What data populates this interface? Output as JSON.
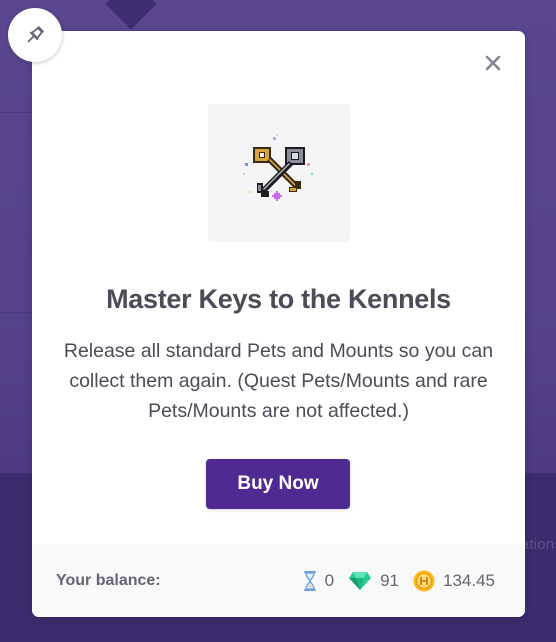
{
  "background": {
    "side_text": "ations"
  },
  "modal": {
    "title": "Master Keys to the Kennels",
    "description": "Release all standard Pets and Mounts so you can collect them again. (Quest Pets/Mounts and rare Pets/Mounts are not affected.)",
    "buy_label": "Buy Now",
    "item_icon": "master-keys-icon",
    "close_icon": "close-icon"
  },
  "footer": {
    "balance_label": "Your balance:",
    "hourglasses": "0",
    "gems": "91",
    "gold": "134.45"
  },
  "pin": {
    "icon": "pin-icon"
  },
  "colors": {
    "brand_purple": "#4f2a93",
    "gem_green": "#24cc8f",
    "gold": "#fdb81e",
    "text": "#4e4a57"
  }
}
